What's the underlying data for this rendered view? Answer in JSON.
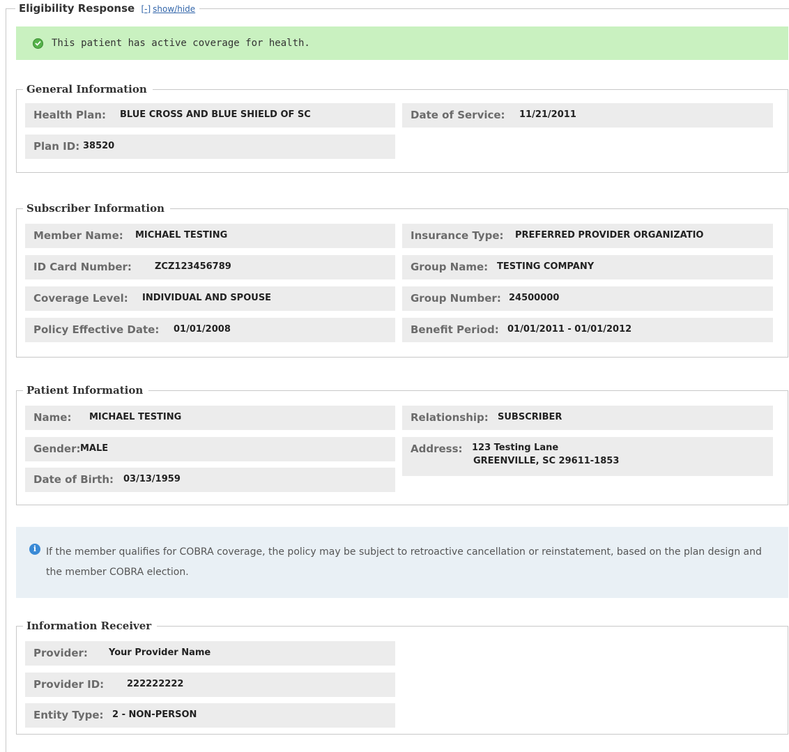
{
  "header": {
    "title": "Eligibility Response",
    "toggle_bracket": "[-]",
    "toggle_link": "show/hide"
  },
  "banner": {
    "message": "This patient has active coverage for health.",
    "icon": "check-circle-icon",
    "color": "#c9f1c0"
  },
  "general": {
    "title": "General Information",
    "health_plan": {
      "label": "Health Plan:",
      "value": "BLUE CROSS AND BLUE SHIELD OF SC"
    },
    "date_of_service": {
      "label": "Date of Service:",
      "value": "11/21/2011"
    },
    "plan_id": {
      "label": "Plan ID:",
      "value": "38520"
    }
  },
  "subscriber": {
    "title": "Subscriber Information",
    "member_name": {
      "label": "Member Name:",
      "value": "MICHAEL TESTING"
    },
    "insurance_type": {
      "label": "Insurance Type:",
      "value": "PREFERRED PROVIDER ORGANIZATIO"
    },
    "id_card": {
      "label": "ID Card Number:",
      "value": "ZCZ123456789"
    },
    "group_name": {
      "label": "Group Name:",
      "value": "TESTING COMPANY"
    },
    "coverage_level": {
      "label": "Coverage Level:",
      "value": "INDIVIDUAL AND SPOUSE"
    },
    "group_number": {
      "label": "Group Number:",
      "value": "24500000"
    },
    "policy_effective": {
      "label": "Policy Effective Date:",
      "value": "01/01/2008"
    },
    "benefit_period": {
      "label": "Benefit Period:",
      "value": "01/01/2011 - 01/01/2012"
    }
  },
  "patient": {
    "title": "Patient Information",
    "name": {
      "label": "Name:",
      "value": "MICHAEL TESTING"
    },
    "relationship": {
      "label": "Relationship:",
      "value": "SUBSCRIBER"
    },
    "gender": {
      "label": "Gender:",
      "value": "MALE"
    },
    "address": {
      "label": "Address:",
      "line1": "123 Testing Lane",
      "line2": "GREENVILLE, SC 29611-1853"
    },
    "dob": {
      "label": "Date of Birth:",
      "value": "03/13/1959"
    }
  },
  "cobra_notice": {
    "icon": "info-icon",
    "text": "If the member qualifies for COBRA coverage, the policy may be subject to retroactive cancellation or reinstatement, based on the plan design and the member COBRA election."
  },
  "receiver": {
    "title": "Information Receiver",
    "provider": {
      "label": "Provider:",
      "value": "Your Provider Name"
    },
    "provider_id": {
      "label": "Provider ID:",
      "value": "222222222"
    },
    "entity_type": {
      "label": "Entity Type:",
      "value": "2 - NON-PERSON"
    }
  }
}
